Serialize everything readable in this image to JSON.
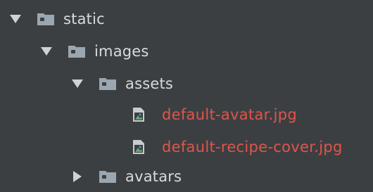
{
  "colors": {
    "background": "#3c3f41",
    "folder_text": "#d8dade",
    "file_text": "#e0554b",
    "folder_icon": "#9aa7b0",
    "arrow": "#d0d3d6"
  },
  "tree": {
    "nodes": [
      {
        "label": "static",
        "type": "folder",
        "expanded": true,
        "depth": 0,
        "icon": "folder-icon"
      },
      {
        "label": "images",
        "type": "folder",
        "expanded": true,
        "depth": 1,
        "icon": "folder-icon"
      },
      {
        "label": "assets",
        "type": "folder",
        "expanded": true,
        "depth": 2,
        "icon": "folder-icon"
      },
      {
        "label": "default-avatar.jpg",
        "type": "file",
        "depth": 3,
        "icon": "image-file-icon"
      },
      {
        "label": "default-recipe-cover.jpg",
        "type": "file",
        "depth": 3,
        "icon": "image-file-icon"
      },
      {
        "label": "avatars",
        "type": "folder",
        "expanded": false,
        "depth": 2,
        "icon": "folder-icon"
      }
    ]
  }
}
